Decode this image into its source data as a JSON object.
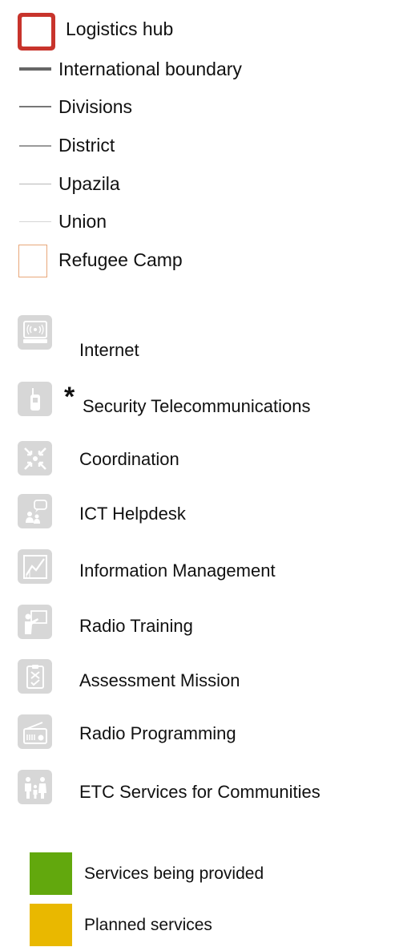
{
  "legend": {
    "boundaries": [
      {
        "label": "Logistics hub",
        "icon": "logistics-hub-icon",
        "color": "#c8342c"
      },
      {
        "label": "International boundary",
        "icon": "international-boundary-line",
        "color": "#666666"
      },
      {
        "label": "Divisions",
        "icon": "divisions-line",
        "color": "#777777"
      },
      {
        "label": "District",
        "icon": "district-line",
        "color": "#9a9a9a"
      },
      {
        "label": "Upazila",
        "icon": "upazila-line",
        "color": "#b8b8b8"
      },
      {
        "label": "Union",
        "icon": "union-line",
        "color": "#d6d6d6"
      },
      {
        "label": "Refugee Camp",
        "icon": "refugee-camp-icon",
        "color": "#e8a77a"
      }
    ],
    "services": [
      {
        "label": "Internet",
        "icon": "internet-icon"
      },
      {
        "label": "Security Telecommunications",
        "icon": "radio-handset-icon",
        "mark": "*"
      },
      {
        "label": "Coordination",
        "icon": "coordination-icon"
      },
      {
        "label": "ICT Helpdesk",
        "icon": "helpdesk-icon"
      },
      {
        "label": "Information Management",
        "icon": "information-management-icon"
      },
      {
        "label": "Radio Training",
        "icon": "radio-training-icon"
      },
      {
        "label": "Assessment Mission",
        "icon": "assessment-mission-icon"
      },
      {
        "label": "Radio Programming",
        "icon": "radio-programming-icon"
      },
      {
        "label": "ETC Services for Communities",
        "icon": "community-services-icon"
      }
    ],
    "status": [
      {
        "label": "Services being provided",
        "color": "#62a80d"
      },
      {
        "label": "Planned services",
        "color": "#e9b800"
      }
    ]
  },
  "colors": {
    "icon_background": "#d7d7d7",
    "icon_foreground": "#ffffff"
  }
}
